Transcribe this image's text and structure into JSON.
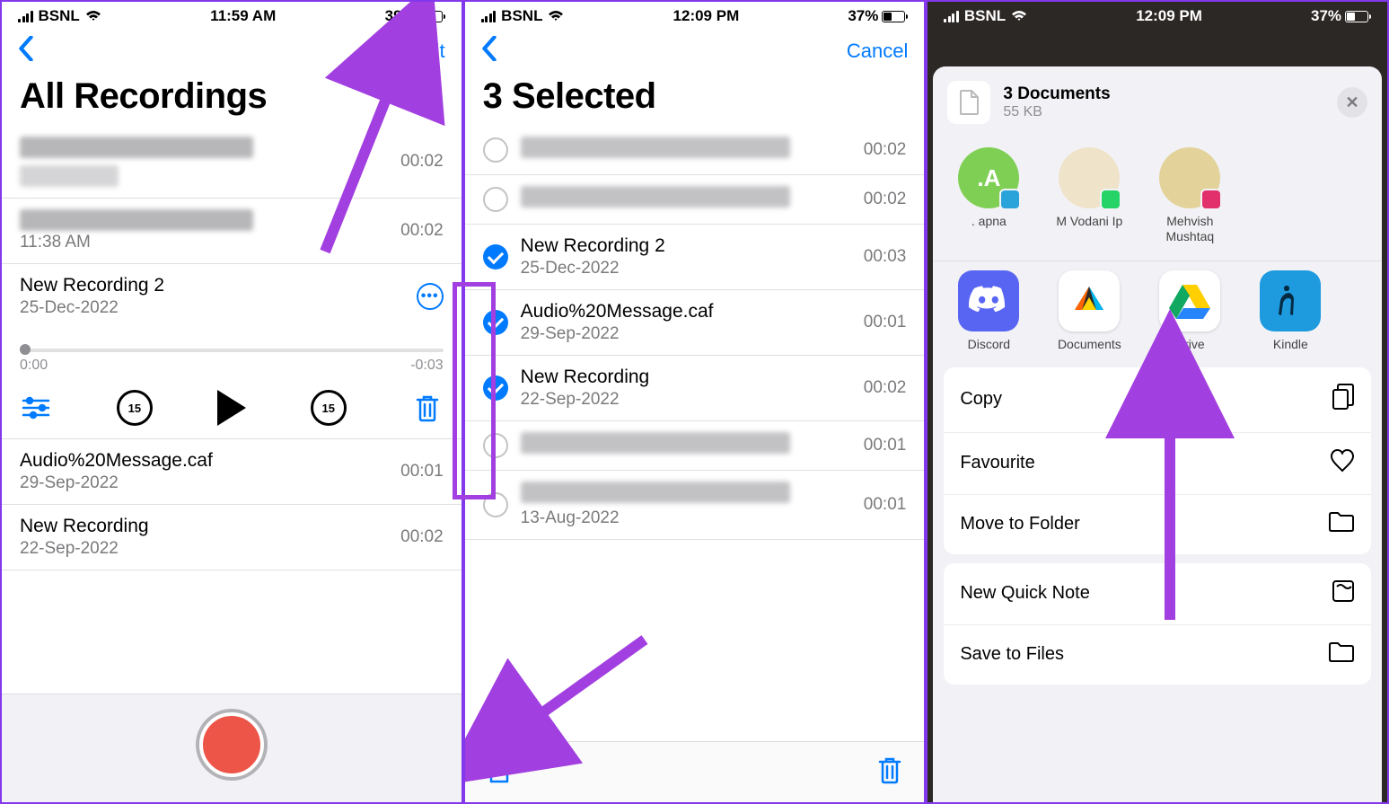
{
  "panel1": {
    "status": {
      "carrier": "BSNL",
      "time": "11:59 AM",
      "battery_pct": "39%",
      "battery_fill_width": "39%"
    },
    "nav": {
      "edit": "Edit"
    },
    "title": "All Recordings",
    "rows": [
      {
        "kind": "blurred",
        "duration": "00:02"
      },
      {
        "kind": "blurred",
        "sub": "11:38 AM",
        "duration": "00:02"
      },
      {
        "kind": "selected",
        "title": "New Recording 2",
        "sub": "25-Dec-2022"
      },
      {
        "kind": "normal",
        "title": "Audio%20Message.caf",
        "sub": "29-Sep-2022",
        "duration": "00:01"
      },
      {
        "kind": "normal",
        "title": "New Recording",
        "sub": "22-Sep-2022",
        "duration": "00:02"
      }
    ],
    "player": {
      "elapsed": "0:00",
      "remaining": "-0:03",
      "skip": "15"
    }
  },
  "panel2": {
    "status": {
      "carrier": "BSNL",
      "time": "12:09 PM",
      "battery_pct": "37%",
      "battery_fill_width": "37%"
    },
    "nav": {
      "cancel": "Cancel"
    },
    "title": "3 Selected",
    "rows": [
      {
        "checked": false,
        "blurred": true,
        "duration": "00:02"
      },
      {
        "checked": false,
        "blurred": true,
        "duration": "00:02"
      },
      {
        "checked": true,
        "title": "New Recording 2",
        "sub": "25-Dec-2022",
        "duration": "00:03"
      },
      {
        "checked": true,
        "title": "Audio%20Message.caf",
        "sub": "29-Sep-2022",
        "duration": "00:01"
      },
      {
        "checked": true,
        "title": "New Recording",
        "sub": "22-Sep-2022",
        "duration": "00:02"
      },
      {
        "checked": false,
        "blurred": true,
        "duration": "00:01"
      },
      {
        "checked": false,
        "blurred": true,
        "sub": "13-Aug-2022",
        "duration": "00:01"
      }
    ]
  },
  "panel3": {
    "status": {
      "carrier": "BSNL",
      "time": "12:09 PM",
      "battery_pct": "37%",
      "battery_fill_width": "37%"
    },
    "share": {
      "title": "3 Documents",
      "size": "55 KB"
    },
    "contacts": [
      {
        "name": ". apna",
        "bg": "#7fcf55",
        "initial": ".A",
        "badge_color": "#2aa3da"
      },
      {
        "name": "M Vodani Ip",
        "bg": "#efe3c9",
        "badge_color": "#25d366"
      },
      {
        "name": "Mehvish Mushtaq",
        "bg": "#e3d29a",
        "badge_color": "#e1306c"
      }
    ],
    "apps": [
      {
        "name": "Discord",
        "bg": "#5865f2"
      },
      {
        "name": "Documents",
        "bg": "#fff"
      },
      {
        "name": "Drive",
        "bg": "#fff"
      },
      {
        "name": "Kindle",
        "bg": "#1e9adf"
      }
    ],
    "actions1": [
      {
        "label": "Copy",
        "icon": "copy"
      },
      {
        "label": "Favourite",
        "icon": "heart"
      },
      {
        "label": "Move to Folder",
        "icon": "folder"
      }
    ],
    "actions2": [
      {
        "label": "New Quick Note",
        "icon": "note"
      },
      {
        "label": "Save to Files",
        "icon": "folder"
      }
    ]
  },
  "colors": {
    "accent": "#007aff",
    "arrow": "#a23fe0"
  }
}
